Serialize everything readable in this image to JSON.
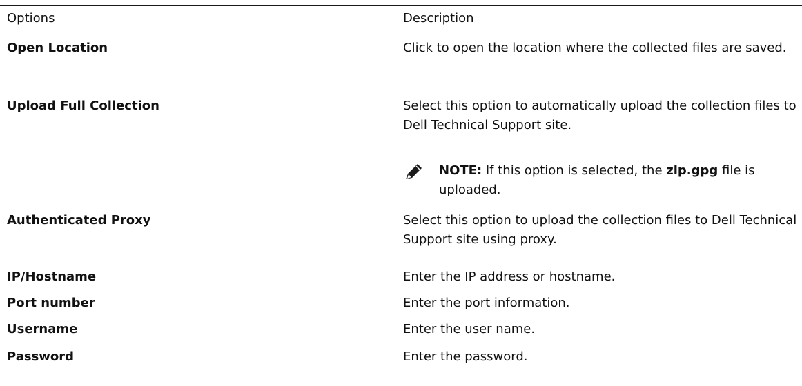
{
  "table": {
    "headers": {
      "options": "Options",
      "description": "Description"
    },
    "rows": [
      {
        "option": "Open Location",
        "description": "Click to open the location where the collected files are saved."
      },
      {
        "option": "Upload Full Collection",
        "description": "Select this option to automatically upload the collection files to Dell Technical Support site."
      },
      {
        "option": "Authenticated Proxy",
        "description": "Select this option to upload the collection files to Dell Technical Support site using proxy."
      },
      {
        "option": "IP/Hostname",
        "description": "Enter the IP address or hostname."
      },
      {
        "option": "Port number",
        "description": "Enter the port information."
      },
      {
        "option": "Username",
        "description": "Enter the user name."
      },
      {
        "option": "Password",
        "description": "Enter the password."
      }
    ],
    "note": {
      "label": "NOTE:",
      "text_before": "If this option is selected, the",
      "filename": "zip.gpg",
      "text_after": "file is uploaded.",
      "icon": "pencil-icon"
    }
  }
}
